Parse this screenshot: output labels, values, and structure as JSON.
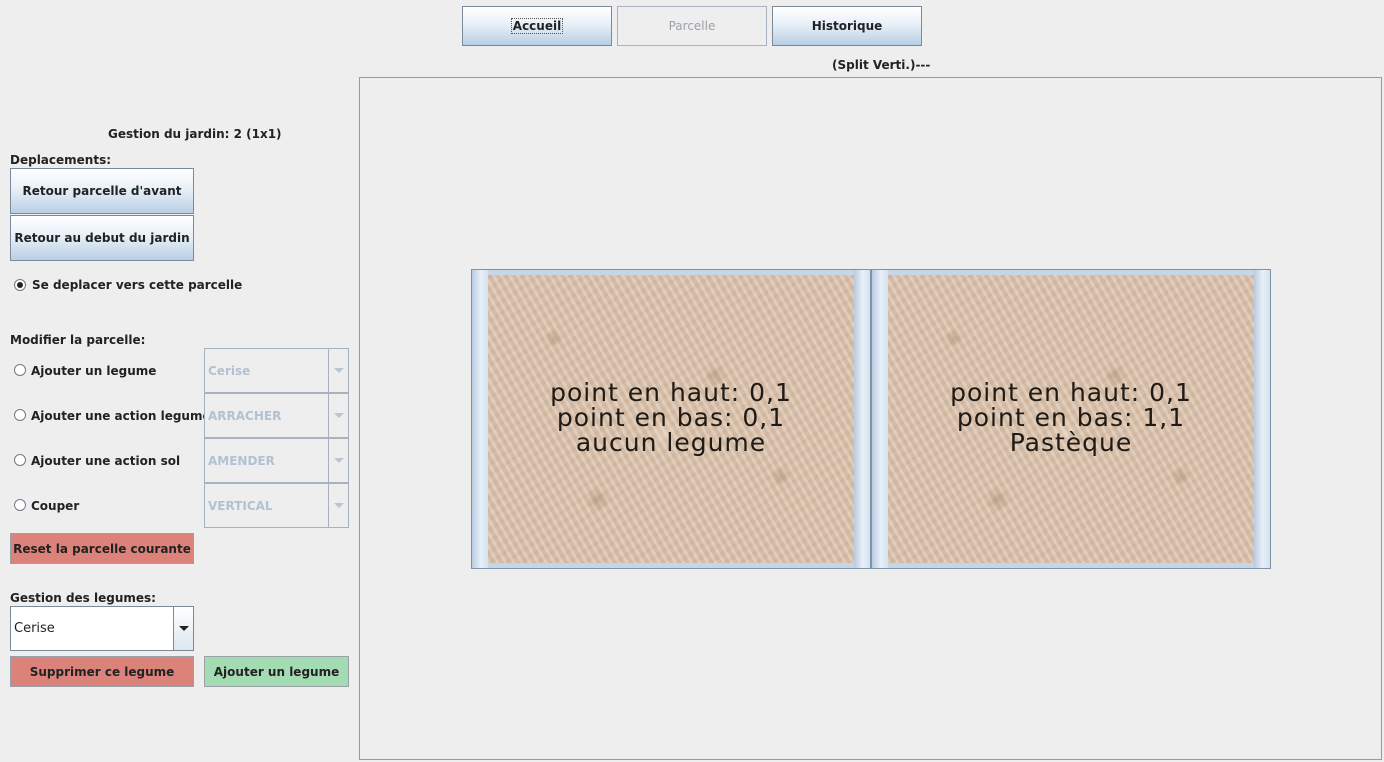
{
  "nav": {
    "accueil": "Accueil",
    "parcelle": "Parcelle",
    "historique": "Historique"
  },
  "split_label": "(Split Verti.)---",
  "sidebar": {
    "gestion_jardin": "Gestion du jardin: 2 (1x1)",
    "deplacements_label": "Deplacements:",
    "retour_avant": "Retour parcelle d'avant",
    "retour_debut": "Retour au debut du jardin",
    "se_deplacer": "Se deplacer vers cette parcelle",
    "modifier_label": "Modifier la parcelle:",
    "actions": [
      {
        "label": "Ajouter un legume",
        "value": "Cerise"
      },
      {
        "label": "Ajouter une action legume",
        "value": "ARRACHER"
      },
      {
        "label": "Ajouter une action sol",
        "value": "AMENDER"
      },
      {
        "label": "Couper",
        "value": "VERTICAL"
      }
    ],
    "reset": "Reset la parcelle courante",
    "legumes_label": "Gestion des legumes:",
    "legume_selected": "Cerise",
    "supprimer": "Supprimer ce legume",
    "ajouter": "Ajouter un legume"
  },
  "parcelles": [
    {
      "haut": "point en haut: 0,1",
      "bas": "point en bas: 0,1",
      "legume": "aucun legume"
    },
    {
      "haut": "point en haut: 0,1",
      "bas": "point en bas: 1,1",
      "legume": "Pastèque"
    }
  ],
  "colors": {
    "reset": "#db827a",
    "supprimer": "#db827a",
    "ajouter": "#a3dbb2"
  }
}
